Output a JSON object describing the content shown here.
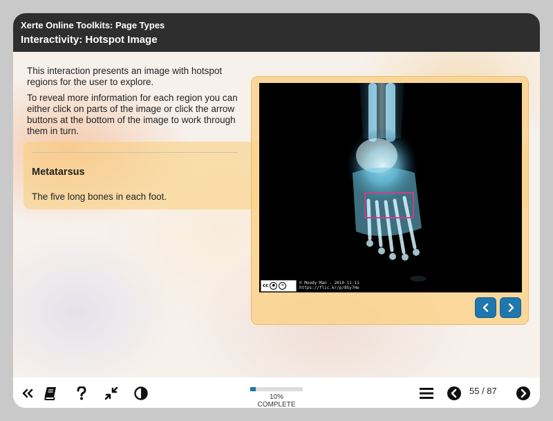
{
  "header": {
    "course_title": "Xerte Online Toolkits: Page Types",
    "page_title": "Interactivity: Hotspot Image"
  },
  "intro": {
    "paragraph1": "This interaction presents an image with hotspot regions for the user to explore.",
    "paragraph2": "To reveal more information for each region you can either click on parts of the image or click the arrow buttons at the bottom of the image to work through them in turn."
  },
  "region": {
    "title": "Metatarsus",
    "description": "The five long bones in each foot."
  },
  "image": {
    "alt": "X-ray foot",
    "credit_line1": "© Moody Man - 2010-11-11",
    "credit_line2": "https://flic.kr/p/8Sy7He",
    "cc_label": "cc"
  },
  "nav": {
    "prev_icon": "chevron-left-icon",
    "next_icon": "chevron-right-icon"
  },
  "footer": {
    "progress_percent": 10,
    "progress_label": "10% COMPLETE",
    "page_counter": "55 / 87",
    "icons": [
      "collapse-sidebar-icon",
      "glossary-book-icon",
      "help-icon",
      "minimize-icon",
      "contrast-icon",
      "menu-icon",
      "previous-page-icon",
      "next-page-icon"
    ]
  },
  "colors": {
    "accent": "#1f77ad",
    "header_bg": "#2e2e2e",
    "hotspot_border": "#c8418a"
  }
}
